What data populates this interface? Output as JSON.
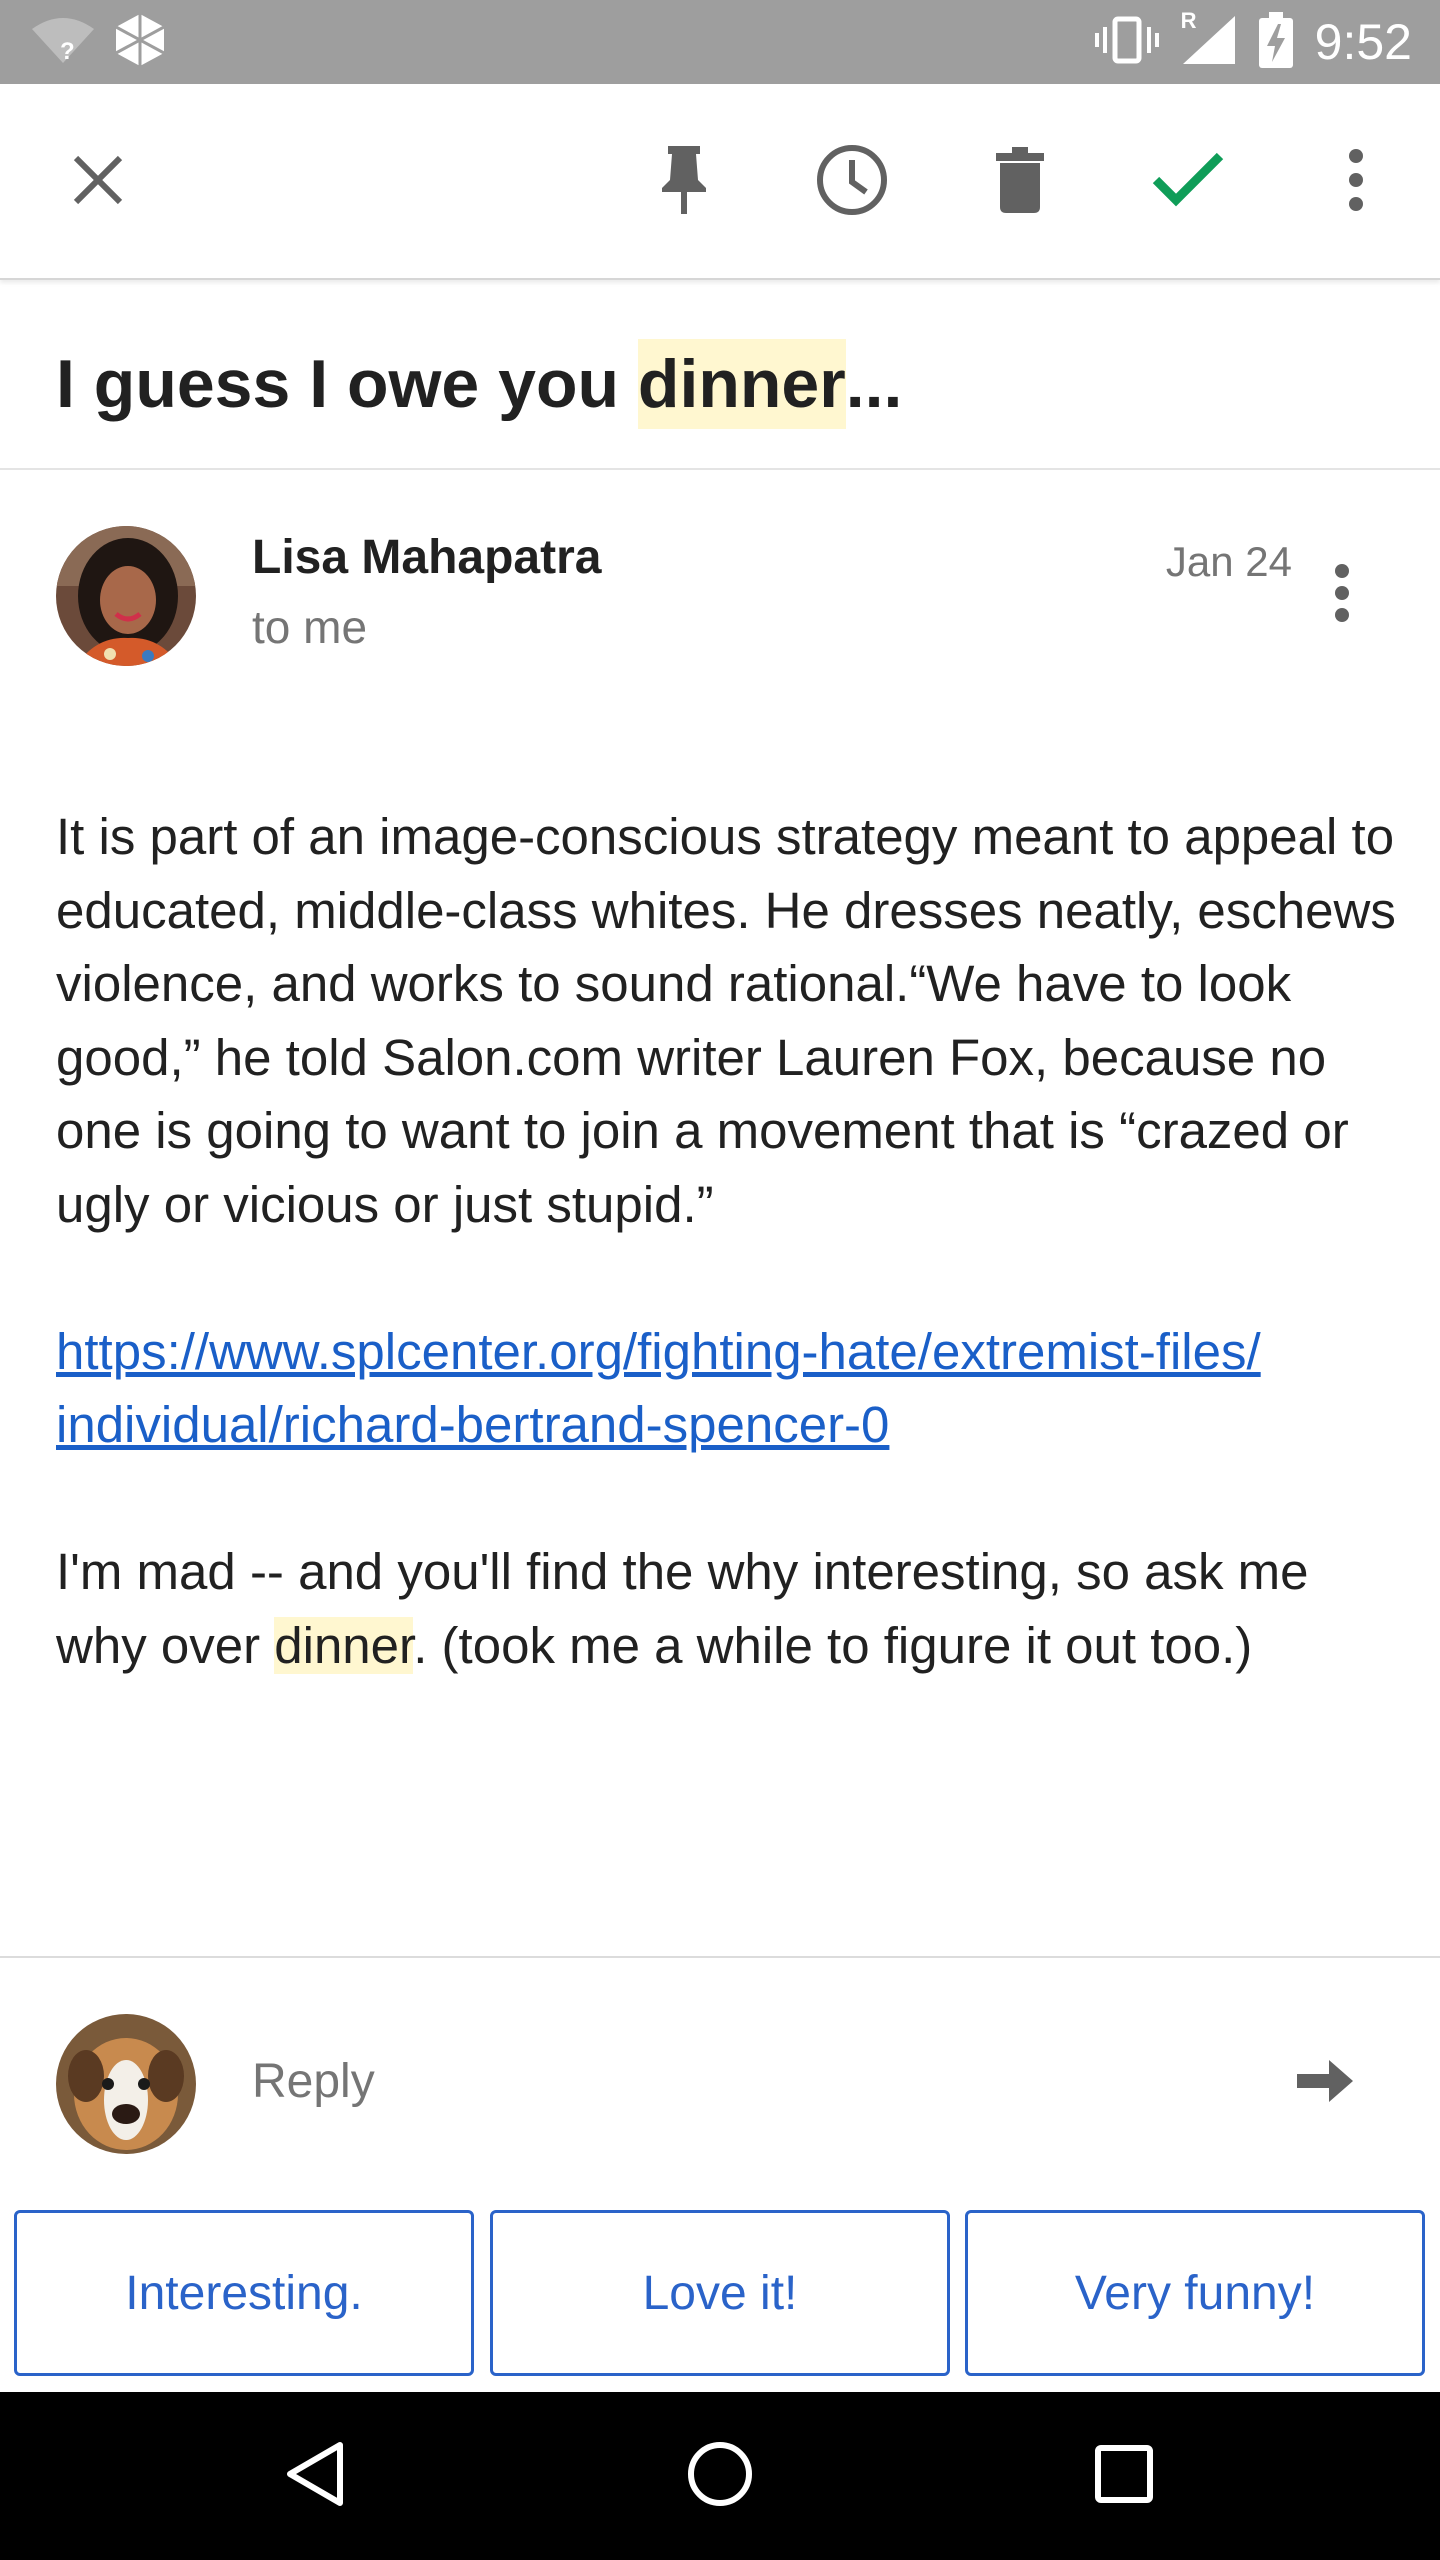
{
  "status_bar": {
    "time": "9:52",
    "network_roaming": "R",
    "icons": [
      "wifi-unknown-icon",
      "app-notification-icon",
      "vibrate-icon",
      "signal-icon",
      "battery-charging-icon"
    ]
  },
  "toolbar": {
    "actions": [
      "close-icon",
      "pin-icon",
      "snooze-icon",
      "delete-icon",
      "done-icon",
      "more-vert-icon"
    ],
    "done_color": "#0f9d58"
  },
  "email": {
    "subject_before": "I guess I owe you ",
    "subject_highlight": "dinner",
    "subject_after": "...",
    "sender": "Lisa Mahapatra",
    "recipient": "to me",
    "date": "Jan 24",
    "body_paragraph_1": "It is part of an image-conscious strategy meant to appeal to educated, middle-class whites. He dresses neatly, eschews violence, and works to sound rational.“We have to look good,” he told Salon.com writer Lauren Fox, because no one is going to want to join a movement that is “crazed or ugly or vicious or just stupid.”",
    "link_line_1": "https://www.splcenter.org/fighting-hate/extremist-files/",
    "link_line_2": "individual/richard-bertrand-spencer-0",
    "body_paragraph_3_before": "I'm mad -- and you'll find the why interesting, so ask me why over ",
    "body_paragraph_3_highlight": "dinner",
    "body_paragraph_3_after": ". (took me a while to figure it out too.)"
  },
  "reply": {
    "placeholder": "Reply"
  },
  "smart_replies": [
    "Interesting.",
    "Love it!",
    "Very funny!"
  ],
  "colors": {
    "status_bar": "#9e9e9e",
    "link": "#1a5fc8",
    "highlight": "#fff7d0",
    "smart_reply": "#2a63c9"
  },
  "nav_bar": {
    "buttons": [
      "back-icon",
      "home-icon",
      "recents-icon"
    ]
  }
}
